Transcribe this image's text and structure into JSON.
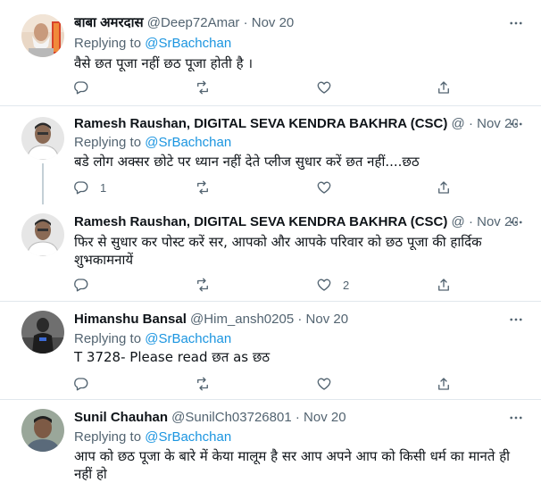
{
  "tweets": [
    {
      "name": "बाबा अमरदास",
      "handle": "@Deep72Amar",
      "dot": "·",
      "time": "Nov 20",
      "replying_label": "Replying to",
      "replying_mention": "@SrBachchan",
      "text": "वैसे छत पूजा नहीं छठ पूजा होती है ।",
      "reply_count": "",
      "retweet_count": "",
      "like_count": ""
    },
    {
      "name": "Ramesh Raushan, DIGITAL SEVA KENDRA BAKHRA (CSC)",
      "handle": "@",
      "dot": "·",
      "time": "Nov 20",
      "replying_label": "Replying to",
      "replying_mention": "@SrBachchan",
      "text": "बडे लोग अक्सर छोटे पर ध्यान नहीं देते प्लीज सुधार करें छत नहीं....छठ",
      "reply_count": "1",
      "retweet_count": "",
      "like_count": ""
    },
    {
      "name": "Ramesh Raushan, DIGITAL SEVA KENDRA BAKHRA (CSC)",
      "handle": "@",
      "dot": "·",
      "time": "Nov 20",
      "text": "फिर से सुधार कर पोस्ट करें सर, आपको और आपके परिवार को छठ पूजा की हार्दिक शुभकामनायें",
      "reply_count": "",
      "retweet_count": "",
      "like_count": "2"
    },
    {
      "name": "Himanshu Bansal",
      "handle": "@Him_ansh0205",
      "dot": "·",
      "time": "Nov 20",
      "replying_label": "Replying to",
      "replying_mention": "@SrBachchan",
      "text": "T 3728- Please read छत as छठ",
      "reply_count": "",
      "retweet_count": "",
      "like_count": ""
    },
    {
      "name": "Sunil Chauhan",
      "handle": "@SunilCh03726801",
      "dot": "·",
      "time": "Nov 20",
      "replying_label": "Replying to",
      "replying_mention": "@SrBachchan",
      "text": "आप को छठ पूजा के बारे में केया मालूम है सर आप अपने आप को किसी धर्म का मानते ही नहीं हो"
    }
  ],
  "icons": {
    "reply": "reply-icon",
    "retweet": "retweet-icon",
    "like": "like-icon",
    "share": "share-icon",
    "more": "more-icon"
  },
  "colors": {
    "link": "#1b95e0",
    "secondary_text": "#536471",
    "separator": "#e1e8ed"
  }
}
